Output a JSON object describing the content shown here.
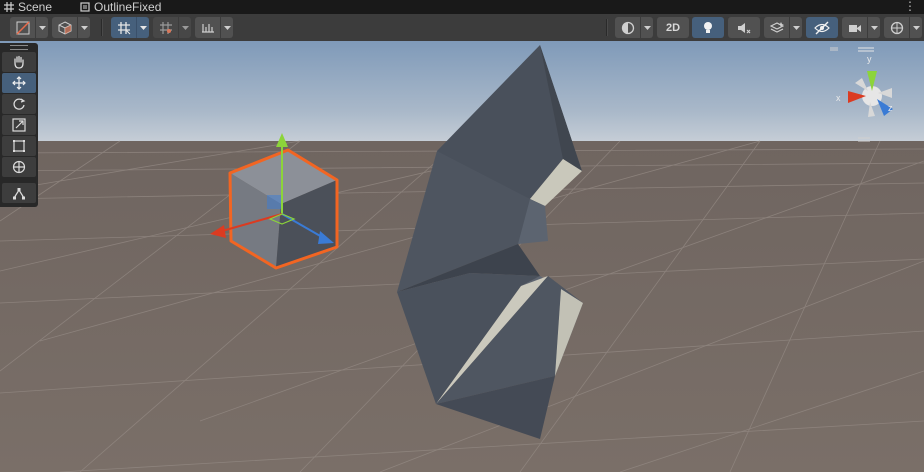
{
  "tabs": [
    {
      "label": "Scene",
      "icon": "hash-icon"
    },
    {
      "label": "OutlineFixed",
      "icon": "scene-file-icon"
    }
  ],
  "toolbar": {
    "render_mode_2d": "2D"
  },
  "tools": [
    "hand-tool",
    "move-tool",
    "rotate-tool",
    "scale-tool",
    "rect-tool",
    "transform-tool",
    "custom-editor-tool"
  ],
  "active_tool": "move-tool",
  "orientation_gizmo": {
    "y_label": "y",
    "x_label": "x",
    "z_label": "z"
  },
  "colors": {
    "selection_outline": "#f26522",
    "x_axis": "#db3b21",
    "y_axis": "#8cd43a",
    "z_axis": "#3a7bd5",
    "sky": "#8fa4bf",
    "ground": "#7a6f68"
  }
}
